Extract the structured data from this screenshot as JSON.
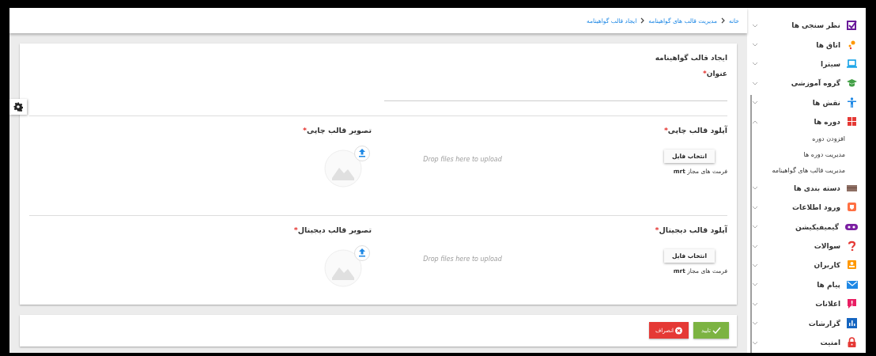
{
  "breadcrumb": [
    {
      "label": "خانه"
    },
    {
      "label": "مدیریت قالب های گواهینامه"
    },
    {
      "label": "ایجاد قالب گواهینامه"
    }
  ],
  "form": {
    "title": "ایجاد قالب گواهینامه",
    "field": {
      "label": "عنوان",
      "required_mark": "*"
    },
    "sections": [
      {
        "upload_title": "آپلود قالب چاپی",
        "required_mark": "*",
        "button": "انتخاب فایل",
        "formats": "فرمت های مجاز **mrt**",
        "drop_hint": "Drop files here to upload",
        "image_title": "تصویر قالب چاپی",
        "image_required_mark": "*"
      },
      {
        "upload_title": "آپلود قالب دیجیتال",
        "required_mark": "*",
        "button": "انتخاب فایل",
        "formats": "فرمت های مجاز **mrt**",
        "drop_hint": "Drop files here to upload",
        "image_title": "تصویر قالب دیجیتال",
        "image_required_mark": "*"
      }
    ]
  },
  "actions": [
    {
      "label": "تایید",
      "kind": "confirm"
    },
    {
      "label": "انصراف",
      "kind": "cancel"
    }
  ],
  "sidebar": {
    "items": [
      {
        "label": "نظر سنجی ها",
        "expanded": false
      },
      {
        "label": "اتاق ها",
        "expanded": false
      },
      {
        "label": "سیترا",
        "expanded": false
      },
      {
        "label": "گروه آموزشی",
        "expanded": false
      },
      {
        "label": "نقش ها",
        "expanded": false
      },
      {
        "label": "دوره ها",
        "expanded": true,
        "children": [
          {
            "label": "افزودن دوره"
          },
          {
            "label": "مدیریت دوره ها"
          },
          {
            "label": "مدیریت قالب های گواهینامه"
          }
        ]
      },
      {
        "label": "دسته بندی ها",
        "expanded": false
      },
      {
        "label": "ورود اطلاعات",
        "expanded": false
      },
      {
        "label": "گیمیفیکیشن",
        "expanded": false
      },
      {
        "label": "سوالات",
        "expanded": false
      },
      {
        "label": "کاربران",
        "expanded": false
      },
      {
        "label": "پیام ها",
        "expanded": false
      },
      {
        "label": "اعلانات",
        "expanded": false
      },
      {
        "label": "گزارشات",
        "expanded": false
      },
      {
        "label": "امنیت",
        "expanded": false
      }
    ]
  }
}
